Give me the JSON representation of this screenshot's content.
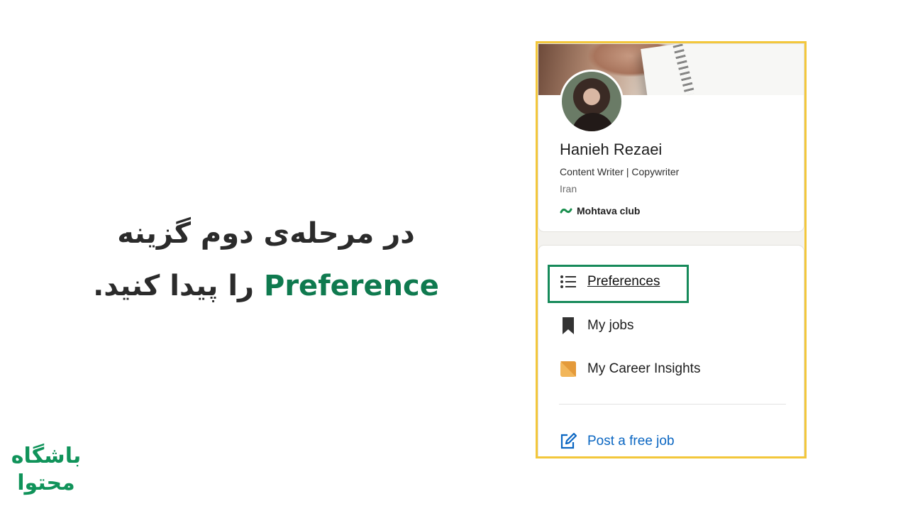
{
  "instruction": {
    "line1": "در مرحله‌ی دوم گزینه",
    "keyword": "Preference",
    "line2_rest": "را پیدا کنید."
  },
  "brand": {
    "line1": "باشگاه",
    "line2": "محتوا"
  },
  "profile": {
    "name": "Hanieh Rezaei",
    "headline": "Content Writer | Copywriter",
    "location": "Iran",
    "company": "Mohtava club"
  },
  "menu": {
    "preferences": "Preferences",
    "my_jobs": "My jobs",
    "career_insights": "My Career Insights",
    "post_job": "Post a free job"
  },
  "colors": {
    "accent_green": "#0f7a4f",
    "highlight_border": "#168a5a",
    "screenshot_border": "#f3c73b",
    "link_blue": "#0a66c2"
  },
  "icons": {
    "preferences": "list-icon",
    "my_jobs": "bookmark-icon",
    "career_insights": "insights-icon",
    "post_job": "edit-icon",
    "company": "company-logo-icon"
  }
}
